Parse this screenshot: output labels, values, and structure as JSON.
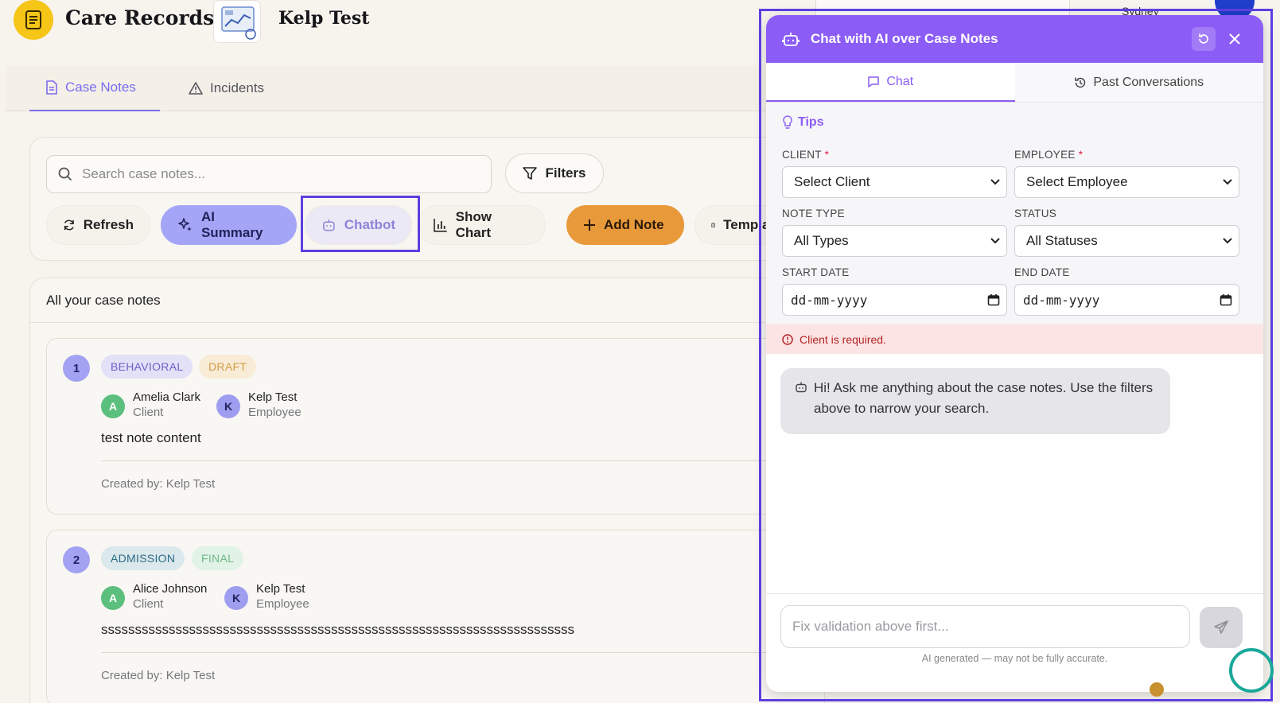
{
  "header": {
    "app_title": "Care Records",
    "user_name": "Kelp Test",
    "city": "Sydney"
  },
  "tabs": [
    {
      "label": "Case Notes",
      "icon": "document-icon",
      "active": true
    },
    {
      "label": "Incidents",
      "icon": "warning-icon",
      "active": false
    }
  ],
  "toolbar": {
    "search_placeholder": "Search case notes...",
    "filters": "Filters",
    "refresh": "Refresh",
    "ai_summary": "AI Summary",
    "chatbot": "Chatbot",
    "show_chart": "Show Chart",
    "add_note": "Add Note",
    "templates": "Templates"
  },
  "notes": {
    "heading": "All your case notes",
    "items": [
      {
        "number": "1",
        "type": "BEHAVIORAL",
        "status": "DRAFT",
        "client": {
          "initial": "A",
          "name": "Amelia Clark",
          "role": "Client"
        },
        "employee": {
          "initial": "K",
          "name": "Kelp Test",
          "role": "Employee"
        },
        "content": "test note content",
        "created_by": "Created by: Kelp Test"
      },
      {
        "number": "2",
        "type": "ADMISSION",
        "status": "FINAL",
        "client": {
          "initial": "A",
          "name": "Alice Johnson",
          "role": "Client"
        },
        "employee": {
          "initial": "K",
          "name": "Kelp Test",
          "role": "Employee"
        },
        "content": "ssssssssssssssssssssssssssssssssssssssssssssssssssssssssssssssssssssss",
        "created_by": "Created by: Kelp Test"
      }
    ]
  },
  "chat": {
    "title": "Chat with AI over Case Notes",
    "tab_chat": "Chat",
    "tab_past": "Past Conversations",
    "tips": "Tips",
    "client_label": "CLIENT",
    "client_value": "Select Client",
    "employee_label": "EMPLOYEE",
    "employee_value": "Select Employee",
    "note_type_label": "NOTE TYPE",
    "note_type_value": "All Types",
    "status_label": "STATUS",
    "status_value": "All Statuses",
    "start_date_label": "START DATE",
    "start_date_value": "dd-mm-yyyy",
    "end_date_label": "END DATE",
    "end_date_value": "dd-mm-yyyy",
    "required_marker": "*",
    "error": "Client is required.",
    "bot_message": "Hi! Ask me anything about the case notes. Use the filters above to narrow your search.",
    "input_placeholder": "Fix validation above first...",
    "disclaimer": "AI generated — may not be fully accurate."
  },
  "colors": {
    "accent": "#8b5cf6",
    "primary_tint": "#a5a5f8",
    "add_note": "#e8993a",
    "logo_yellow": "#f5c518",
    "highlight": "#5b3fe0"
  }
}
